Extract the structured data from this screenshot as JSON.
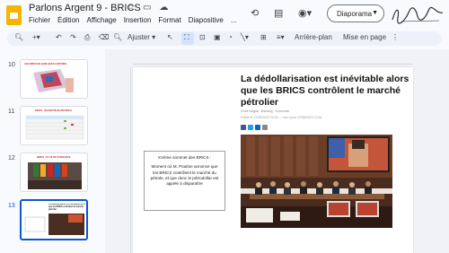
{
  "app": {
    "doc_title": "Parlons Argent 9 - BRICS",
    "menu": [
      "Fichier",
      "Édition",
      "Affichage",
      "Insertion",
      "Format",
      "Diapositive",
      "..."
    ],
    "slideshow_label": "Diaporama",
    "signature_text": "L'Homme"
  },
  "toolbar": {
    "zoom_label": "Ajuster",
    "background_label": "Arrière-plan",
    "layout_label": "Mise en page"
  },
  "filmstrip": {
    "slides": [
      {
        "number": "10",
        "title": "LES BRICS EN QUELQUES CHIFFRES"
      },
      {
        "number": "11",
        "title": "BRICS : QUANTITÉ DE PÉTROLE"
      },
      {
        "number": "12",
        "title": "BRICS : PLUS DE PUISSANCE"
      },
      {
        "number": "13",
        "title": "La dédollarisation est inévitable alors que les BRICS contrôlent le marché pétrolier"
      }
    ]
  },
  "slide": {
    "headline": "La dédollarisation est inévitable alors que les BRICS contrôlent le marché pétrolier",
    "byline": "Vivek Nagda · Banking · Economie",
    "byline2": "Publié le 27/08/2023 10:16 — mis à jour 27/08/2023 12:44",
    "textbox_title": "XVème sommet des BRICS :",
    "textbox_body": "Moment où M. Poutine annonce que les BRICS contrôlent le marché du pétrole, et que donc le pétrodollar est appelé à disparaître"
  },
  "colors": {
    "accent": "#0b57d0",
    "toolbar_bg": "#edf2fa",
    "slides_logo": "#f4b400"
  }
}
